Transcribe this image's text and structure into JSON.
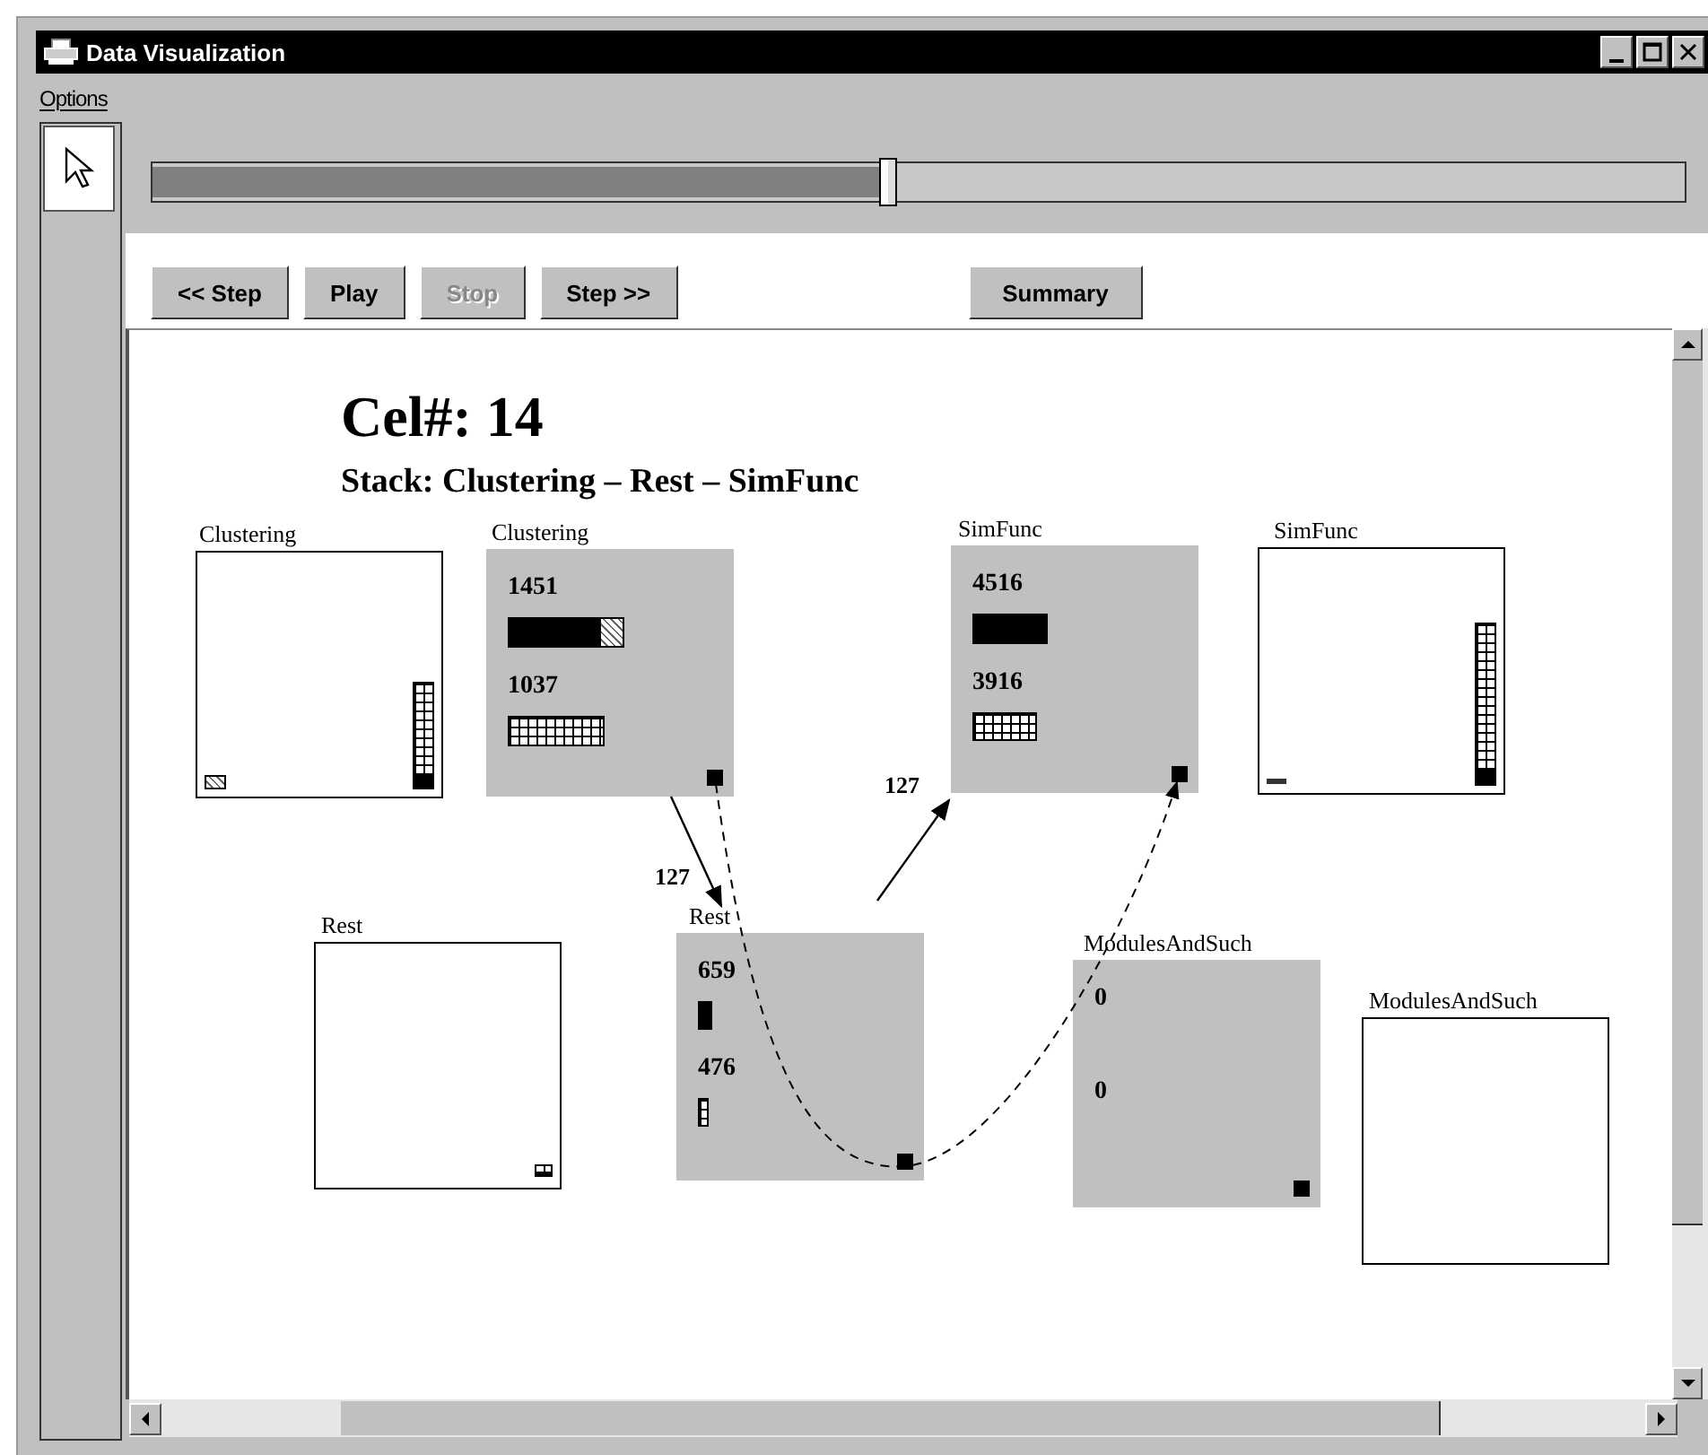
{
  "window": {
    "title": "Data Visualization"
  },
  "menu": [
    {
      "label": "Options"
    }
  ],
  "slider": {
    "level": 0.48
  },
  "buttons": [
    {
      "label": "<< Step",
      "disabled": false
    },
    {
      "label": "Play",
      "disabled": false
    },
    {
      "label": "Stop",
      "disabled": true
    },
    {
      "label": "Step >>",
      "disabled": false
    }
  ],
  "summary_button": {
    "label": "Summary"
  },
  "heading": {
    "title": "Cel#: 14",
    "stack": "Stack: Clustering – Rest – SimFunc"
  },
  "nodes": [
    {
      "label": "Clustering",
      "kind": "history"
    },
    {
      "label": "Clustering",
      "kind": "active",
      "values": [
        {
          "value": "1451",
          "kind": "solid-hatched"
        },
        {
          "value": "1037",
          "kind": "grid"
        }
      ]
    },
    {
      "label": "SimFunc",
      "kind": "active",
      "values": [
        {
          "value": "4516",
          "kind": "solid"
        },
        {
          "value": "3916",
          "kind": "grid"
        }
      ]
    },
    {
      "label": "SimFunc",
      "kind": "history"
    },
    {
      "label": "Rest",
      "kind": "history"
    },
    {
      "label": "Rest",
      "kind": "active",
      "values": [
        {
          "value": "659",
          "kind": "solid"
        },
        {
          "value": "476",
          "kind": "grid"
        }
      ]
    },
    {
      "label": "ModulesAndSuch",
      "kind": "active",
      "values": [
        {
          "value": "0",
          "kind": "plain"
        },
        {
          "value": "0",
          "kind": "plain"
        }
      ]
    },
    {
      "label": "ModulesAndSuch",
      "kind": "history"
    }
  ],
  "edges": [
    {
      "label": "127"
    },
    {
      "label": "127"
    }
  ]
}
